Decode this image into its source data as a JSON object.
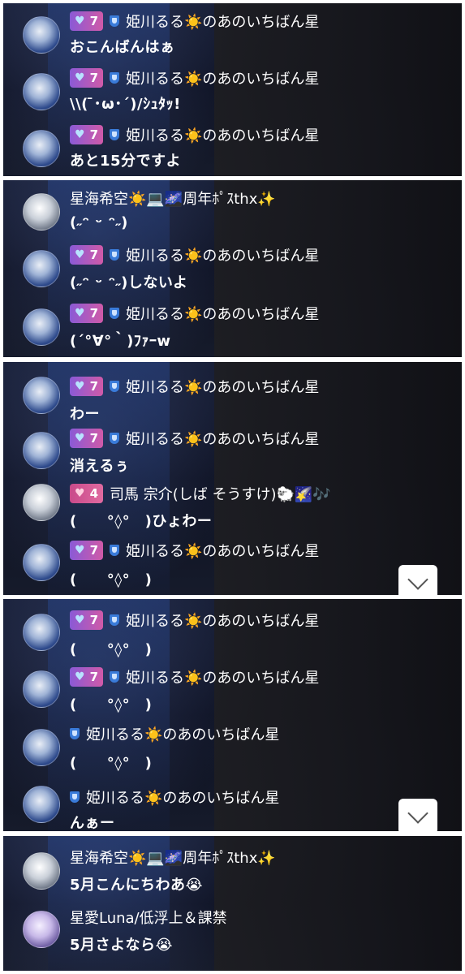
{
  "panels": [
    {
      "messages": [
        {
          "badge": "7",
          "shield": true,
          "name": "姫川るる☀️のあのいちばん星",
          "text": "おこんばんはぁ"
        },
        {
          "badge": "7",
          "shield": true,
          "name": "姫川るる☀️のあのいちばん星",
          "text": "\\\\( ̄･ω･´)/ｼｭﾀｯ!"
        },
        {
          "badge": "7",
          "shield": true,
          "name": "姫川るる☀️のあのいちばん星",
          "text": "あと15分ですよ"
        }
      ]
    },
    {
      "messages": [
        {
          "badge": "",
          "shield": false,
          "name": "星海希空☀️💻🌌周年ﾎﾟｽthx✨",
          "text": "(˶ᵔ ᵕ ᵔ˶)"
        },
        {
          "badge": "7",
          "shield": true,
          "name": "姫川るる☀️のあのいちばん星",
          "text": "(˶ᵔ ᵕ ᵔ˶)しないよ"
        },
        {
          "badge": "7",
          "shield": true,
          "name": "姫川るる☀️のあのいちばん星",
          "text": "(´°∀°｀)ﾌｧｰw"
        }
      ]
    },
    {
      "messages": [
        {
          "badge": "7",
          "shield": true,
          "name": "姫川るる☀️のあのいちばん星",
          "text": "わー"
        },
        {
          "badge": "7",
          "shield": true,
          "name": "姫川るる☀️のあのいちばん星",
          "text": "消えるぅ"
        },
        {
          "badge": "4",
          "shield": false,
          "name": "司馬 宗介(しば そうすけ)🐑🌠🎶",
          "text": "(　　°◊°　)ひょわー"
        },
        {
          "badge": "7",
          "shield": true,
          "name": "姫川るる☀️のあのいちばん星",
          "text": "(　　°◊°　)"
        }
      ]
    },
    {
      "messages": [
        {
          "badge": "7",
          "shield": true,
          "name": "姫川るる☀️のあのいちばん星",
          "text": "(　　°◊°　)"
        },
        {
          "badge": "7",
          "shield": true,
          "name": "姫川るる☀️のあのいちばん星",
          "text": "(　　°◊°　)"
        },
        {
          "badge": "",
          "shield": true,
          "name": "姫川るる☀️のあのいちばん星",
          "text": "(　　°◊°　)"
        },
        {
          "badge": "",
          "shield": true,
          "name": "姫川るる☀️のあのいちばん星",
          "text": "んぁー"
        }
      ]
    },
    {
      "messages": [
        {
          "badge": "",
          "shield": false,
          "name": "星海希空☀️💻🌌周年ﾎﾟｽthx✨",
          "text": "5月こんにちわあ😭"
        },
        {
          "badge": "",
          "shield": false,
          "name": "星愛Luna/低浮上＆課禁",
          "text": "5月さよなら😭"
        }
      ]
    }
  ],
  "scroll_button_icon": "chevron-down-icon"
}
